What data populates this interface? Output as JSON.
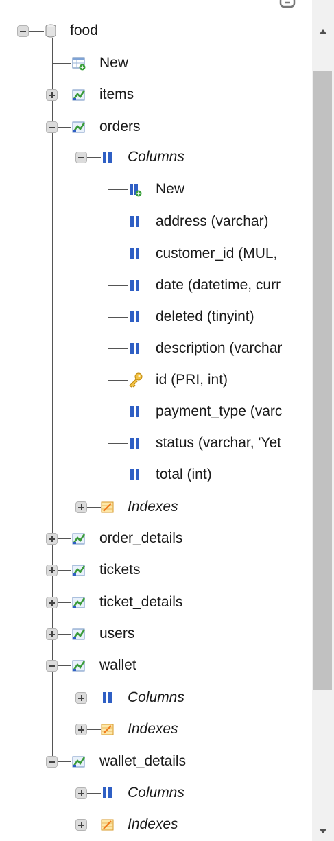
{
  "tree": {
    "database": {
      "label": "food",
      "icon": "database-icon"
    },
    "new_table": {
      "label": "New",
      "icon": "new-table-icon"
    },
    "tables": [
      {
        "label": "items",
        "expanded": false
      },
      {
        "label": "orders",
        "expanded": true,
        "columns_label": "Columns",
        "new_column": "New",
        "columns": [
          {
            "label": "address (varchar)",
            "icon": "column-icon"
          },
          {
            "label": "customer_id (MUL,",
            "icon": "column-icon"
          },
          {
            "label": "date (datetime, curr",
            "icon": "column-icon"
          },
          {
            "label": "deleted (tinyint)",
            "icon": "column-icon"
          },
          {
            "label": "description (varchar",
            "icon": "column-icon"
          },
          {
            "label": "id (PRI, int)",
            "icon": "primary-key-icon"
          },
          {
            "label": "payment_type (varc",
            "icon": "column-icon"
          },
          {
            "label": "status (varchar, 'Yet",
            "icon": "column-icon"
          },
          {
            "label": "total (int)",
            "icon": "column-icon"
          }
        ],
        "indexes_label": "Indexes"
      },
      {
        "label": "order_details",
        "expanded": false
      },
      {
        "label": "tickets",
        "expanded": false
      },
      {
        "label": "ticket_details",
        "expanded": false
      },
      {
        "label": "users",
        "expanded": false
      },
      {
        "label": "wallet",
        "expanded": true,
        "columns_label": "Columns",
        "indexes_label": "Indexes"
      },
      {
        "label": "wallet_details",
        "expanded": true,
        "columns_label": "Columns",
        "indexes_label": "Indexes"
      }
    ]
  },
  "colors": {
    "column_blue": "#2f5fc4",
    "table_green": "#3a9b3a",
    "key_gold": "#e0a020",
    "index_orange": "#f0a030"
  }
}
